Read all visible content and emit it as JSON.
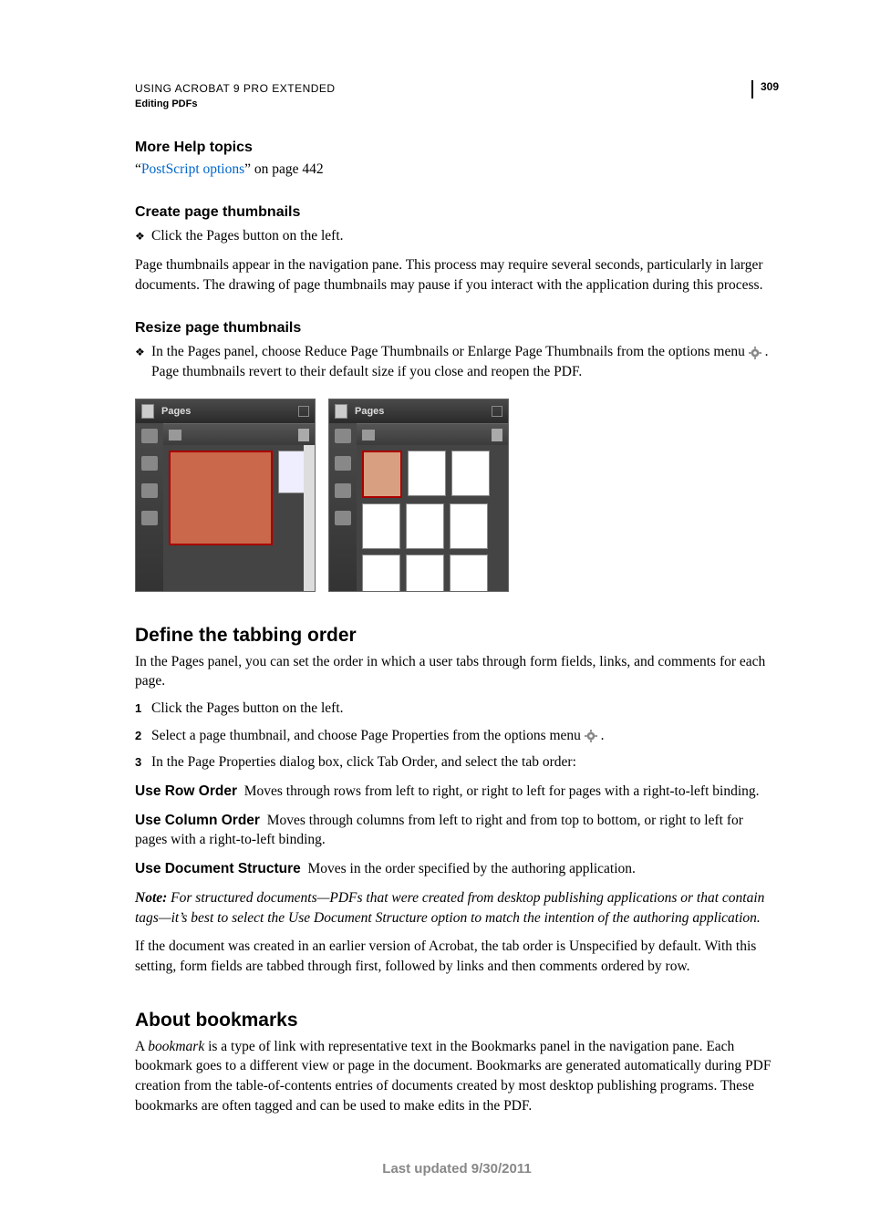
{
  "header": {
    "title": "USING ACROBAT 9 PRO EXTENDED",
    "subtitle": "Editing PDFs",
    "page_number": "309"
  },
  "more_help": {
    "heading": "More Help topics",
    "quote_open": "“",
    "link_text": "PostScript options",
    "after_link": "” on page 442"
  },
  "create_thumbs": {
    "heading": "Create page thumbnails",
    "bullet": "Click the Pages button on the left.",
    "para": "Page thumbnails appear in the navigation pane. This process may require several seconds, particularly in larger documents. The drawing of page thumbnails may pause if you interact with the application during this process."
  },
  "resize_thumbs": {
    "heading": "Resize page thumbnails",
    "bullet_pre": "In the Pages panel, choose Reduce Page Thumbnails or Enlarge Page Thumbnails from the options menu ",
    "bullet_post": ". Page thumbnails revert to their default size if you close and reopen the PDF."
  },
  "panel_label": "Pages",
  "tabbing": {
    "heading": "Define the tabbing order",
    "intro": "In the Pages panel, you can set the order in which a user tabs through form fields, links, and comments for each page.",
    "step1": "Click the Pages button on the left.",
    "step2_pre": "Select a page thumbnail, and choose Page Properties from the options menu ",
    "step2_post": ".",
    "step3": "In the Page Properties dialog box, click Tab Order, and select the tab order:",
    "row_order_term": "Use Row Order",
    "row_order_text": "Moves through rows from left to right, or right to left for pages with a right-to-left binding.",
    "col_order_term": "Use Column Order",
    "col_order_text": "Moves through columns from left to right and from top to bottom, or right to left for pages with a right-to-left binding.",
    "doc_struct_term": "Use Document Structure",
    "doc_struct_text": "Moves in the order specified by the authoring application.",
    "note_label": "Note: ",
    "note_text": "For structured documents—PDFs that were created from desktop publishing applications or that contain tags—it’s best to select the Use Document Structure option to match the intention of the authoring application.",
    "legacy": "If the document was created in an earlier version of Acrobat, the tab order is Unspecified by default. With this setting, form fields are tabbed through first, followed by links and then comments ordered by row."
  },
  "bookmarks": {
    "heading": "About bookmarks",
    "para_pre": "A ",
    "para_em": "bookmark",
    "para_post": " is a type of link with representative text in the Bookmarks panel in the navigation pane. Each bookmark goes to a different view or page in the document. Bookmarks are generated automatically during PDF creation from the table-of-contents entries of documents created by most desktop publishing programs. These bookmarks are often tagged and can be used to make edits in the PDF."
  },
  "footer": "Last updated 9/30/2011"
}
